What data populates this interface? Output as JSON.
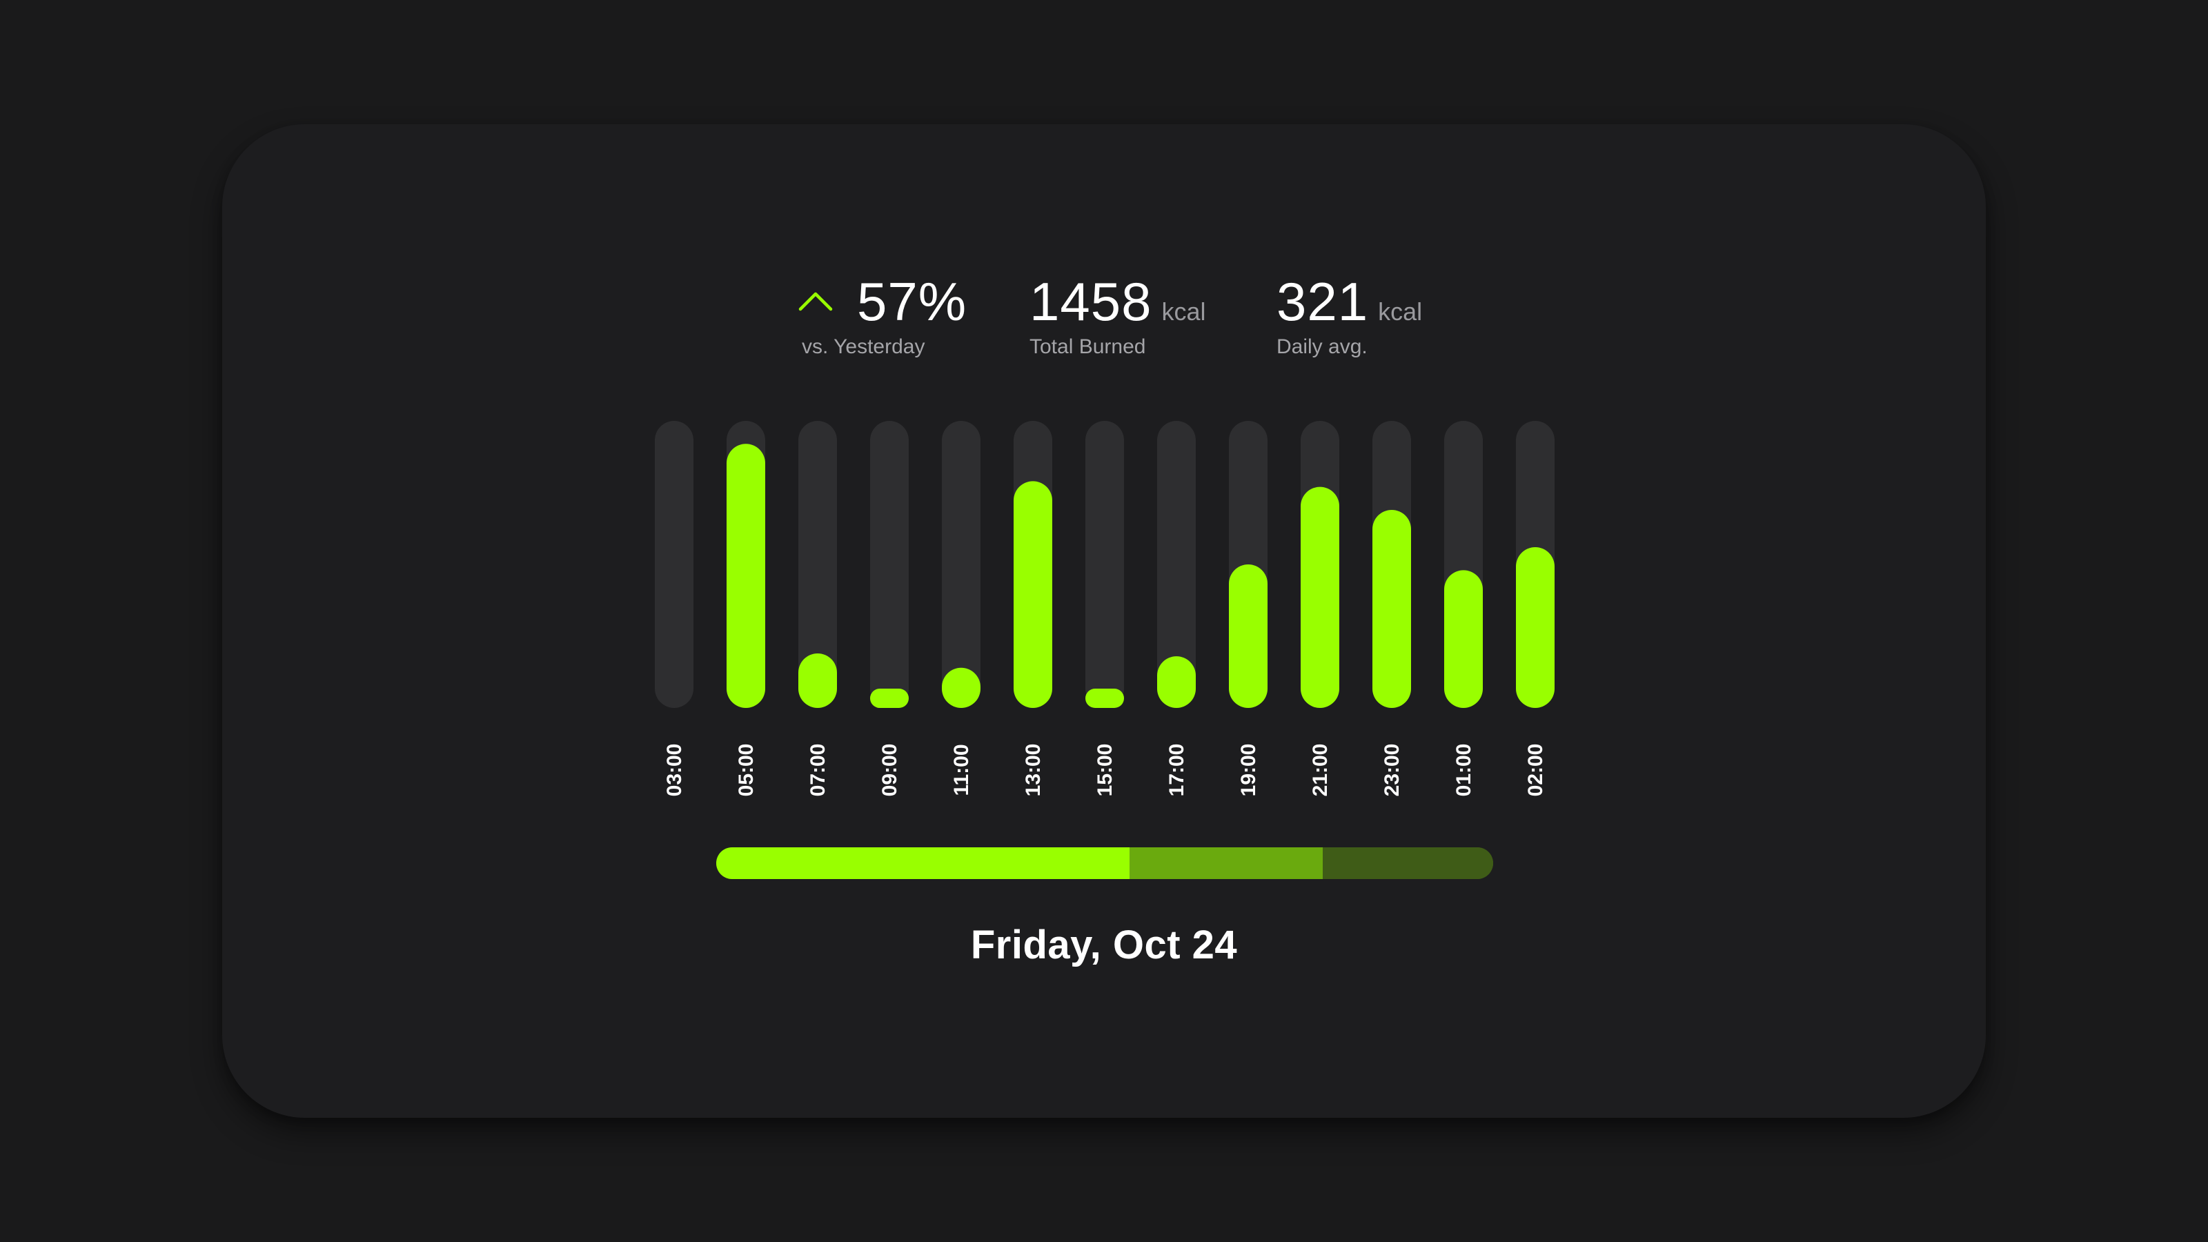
{
  "colors": {
    "background": "#1a1a1b",
    "card": "#1d1d1f",
    "accent": "#99ff00",
    "track": "#2e2e30",
    "segment_mid": "#6aaa0e",
    "segment_dark": "#3f5c17"
  },
  "stats": {
    "change": {
      "icon": "chevron-up-icon",
      "value": "57%",
      "label": "vs. Yesterday"
    },
    "total": {
      "value": "1458",
      "unit": "kcal",
      "label": "Total Burned"
    },
    "average": {
      "value": "321",
      "unit": "kcal",
      "label": "Daily avg."
    }
  },
  "chart_data": {
    "type": "bar",
    "categories": [
      "03:00",
      "05:00",
      "07:00",
      "09:00",
      "11:00",
      "13:00",
      "15:00",
      "17:00",
      "19:00",
      "21:00",
      "23:00",
      "01:00",
      "02:00"
    ],
    "values": [
      0,
      0.92,
      0.19,
      0.06,
      0.14,
      0.79,
      0.06,
      0.18,
      0.5,
      0.77,
      0.69,
      0.48,
      0.56
    ],
    "ylim": [
      0,
      1
    ],
    "grid": false,
    "legend": "none"
  },
  "progress": {
    "segments": [
      {
        "fraction": 0.532,
        "color": "#99ff00"
      },
      {
        "fraction": 0.249,
        "color": "#6aaa0e"
      },
      {
        "fraction": 0.219,
        "color": "#3f5c17"
      }
    ]
  },
  "date": "Friday, Oct 24"
}
